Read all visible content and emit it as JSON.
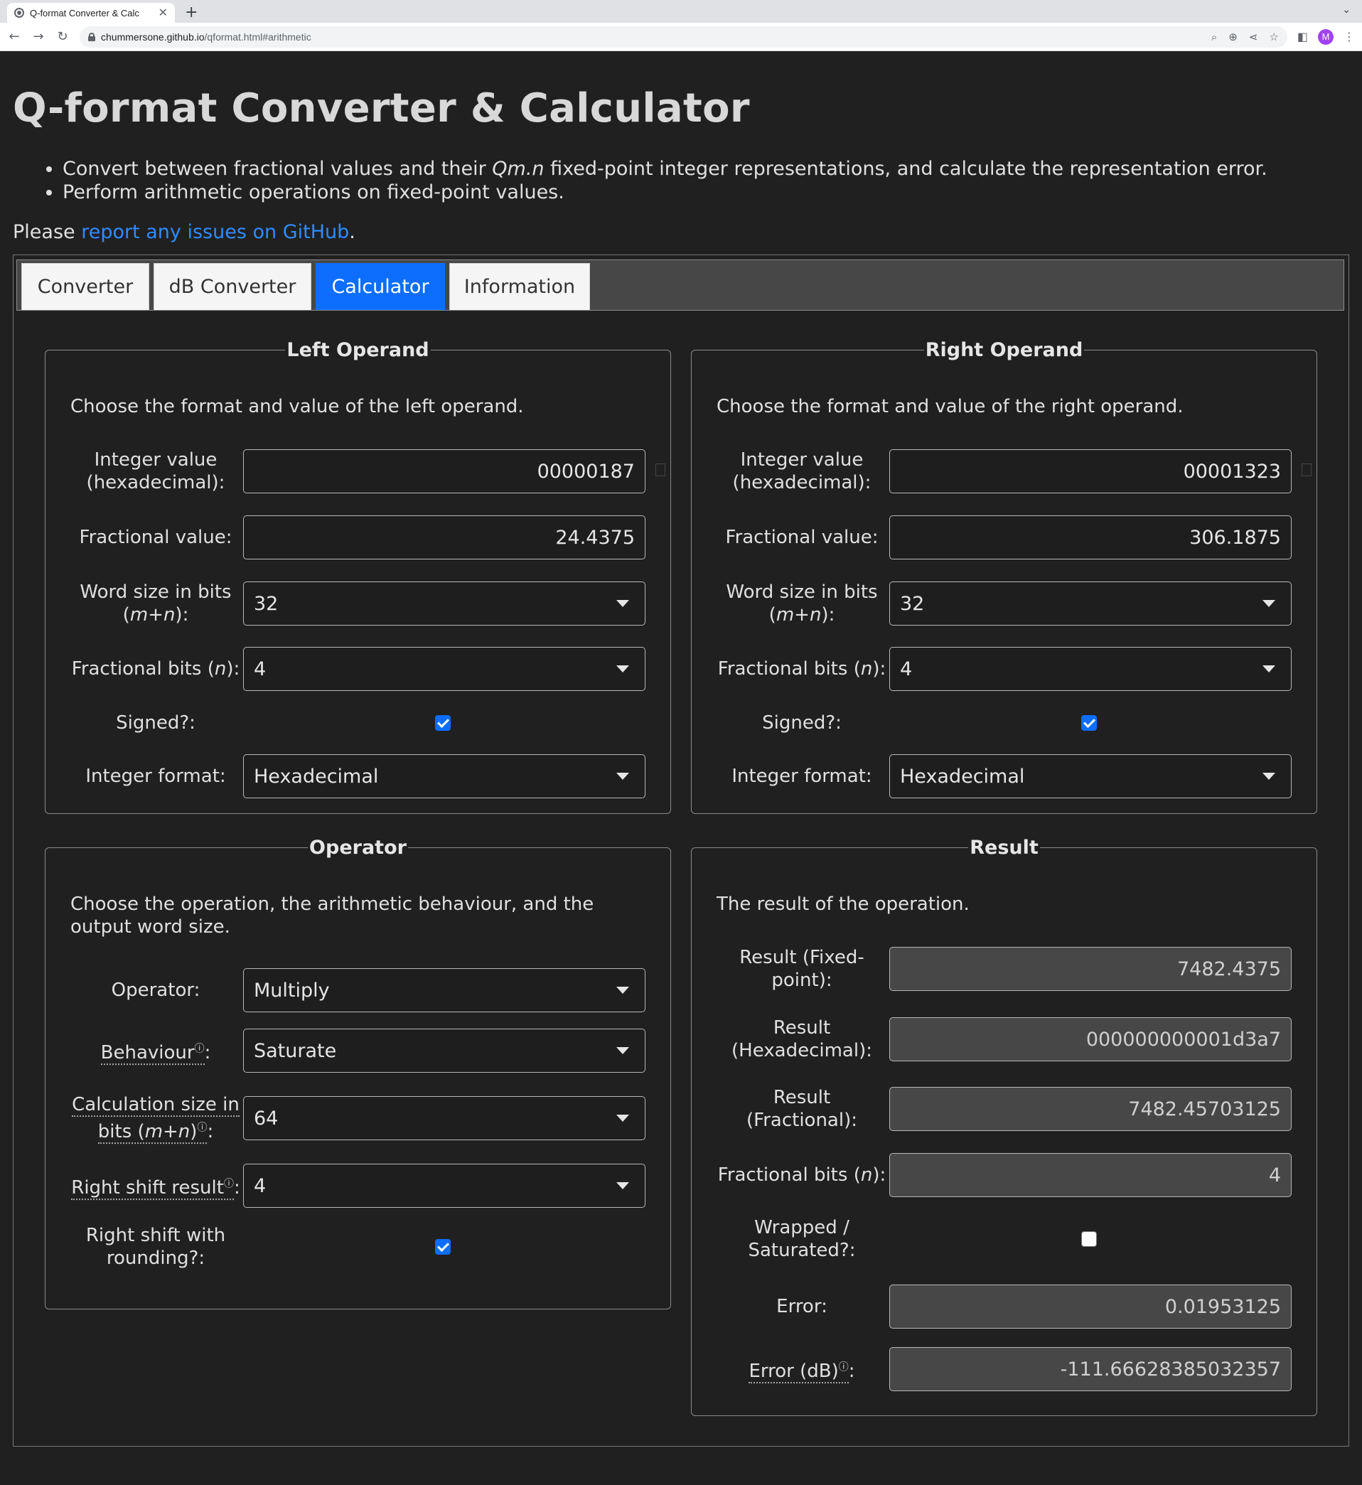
{
  "browser": {
    "tab_title": "Q-format Converter & Calc",
    "url_host": "chummersone.github.io",
    "url_path": "/qformat.html#arithmetic",
    "avatar_letter": "M"
  },
  "page": {
    "title": "Q-format Converter & Calculator",
    "bullets": [
      {
        "pre": "Convert between fractional values and their ",
        "em": "Qm.n",
        "post": " fixed-point integer representations, and calculate the representation error."
      },
      {
        "pre": "Perform arithmetic operations on fixed-point values.",
        "em": "",
        "post": ""
      }
    ],
    "please_pre": "Please ",
    "please_link": "report any issues on GitHub",
    "please_post": "."
  },
  "tabs": [
    "Converter",
    "dB Converter",
    "Calculator",
    "Information"
  ],
  "active_tab": "Calculator",
  "left": {
    "legend": "Left Operand",
    "desc": "Choose the format and value of the left operand.",
    "int_label_1": "Integer value",
    "int_label_2": "(hexadecimal):",
    "int_value": "00000187",
    "frac_label": "Fractional value:",
    "frac_value": "24.4375",
    "word_label_1": "Word size in bits",
    "word_label_2a": "(",
    "word_label_2b": "m+n",
    "word_label_2c": "):",
    "word_value": "32",
    "fbits_label_a": "Fractional bits (",
    "fbits_label_b": "n",
    "fbits_label_c": "):",
    "fbits_value": "4",
    "signed_label": "Signed?:",
    "signed": true,
    "fmt_label": "Integer format:",
    "fmt_value": "Hexadecimal"
  },
  "right": {
    "legend": "Right Operand",
    "desc": "Choose the format and value of the right operand.",
    "int_label_1": "Integer value",
    "int_label_2": "(hexadecimal):",
    "int_value": "00001323",
    "frac_label": "Fractional value:",
    "frac_value": "306.1875",
    "word_label_1": "Word size in bits",
    "word_label_2a": "(",
    "word_label_2b": "m+n",
    "word_label_2c": "):",
    "word_value": "32",
    "fbits_label_a": "Fractional bits (",
    "fbits_label_b": "n",
    "fbits_label_c": "):",
    "fbits_value": "4",
    "signed_label": "Signed?:",
    "signed": true,
    "fmt_label": "Integer format:",
    "fmt_value": "Hexadecimal"
  },
  "operator": {
    "legend": "Operator",
    "desc": "Choose the operation, the arithmetic behaviour, and the output word size.",
    "op_label": "Operator:",
    "op_value": "Multiply",
    "beh_label": "Behaviour",
    "beh_value": "Saturate",
    "calc_label_1": "Calculation size in",
    "calc_label_2a": "bits (",
    "calc_label_2b": "m+n",
    "calc_label_2c": ")",
    "calc_value": "64",
    "rs_label": "Right shift result",
    "rs_value": "4",
    "round_label_1": "Right shift with",
    "round_label_2": "rounding?:",
    "round": true,
    "info_glyph": "ⓘ",
    "colon": ":"
  },
  "result": {
    "legend": "Result",
    "desc": "The result of the operation.",
    "fixed_label_1": "Result (Fixed-",
    "fixed_label_2": "point):",
    "fixed_value": "7482.4375",
    "hex_label_1": "Result",
    "hex_label_2": "(Hexadecimal):",
    "hex_value": "000000000001d3a7",
    "frac_label_1": "Result",
    "frac_label_2": "(Fractional):",
    "frac_value": "7482.45703125",
    "fbits_label_a": "Fractional bits (",
    "fbits_label_b": "n",
    "fbits_label_c": "):",
    "fbits_value": "4",
    "wrap_label_1": "Wrapped /",
    "wrap_label_2": "Saturated?:",
    "wrapped": false,
    "err_label": "Error:",
    "err_value": "0.01953125",
    "errdb_label": "Error (dB)",
    "errdb_value": "-111.66628385032357"
  }
}
